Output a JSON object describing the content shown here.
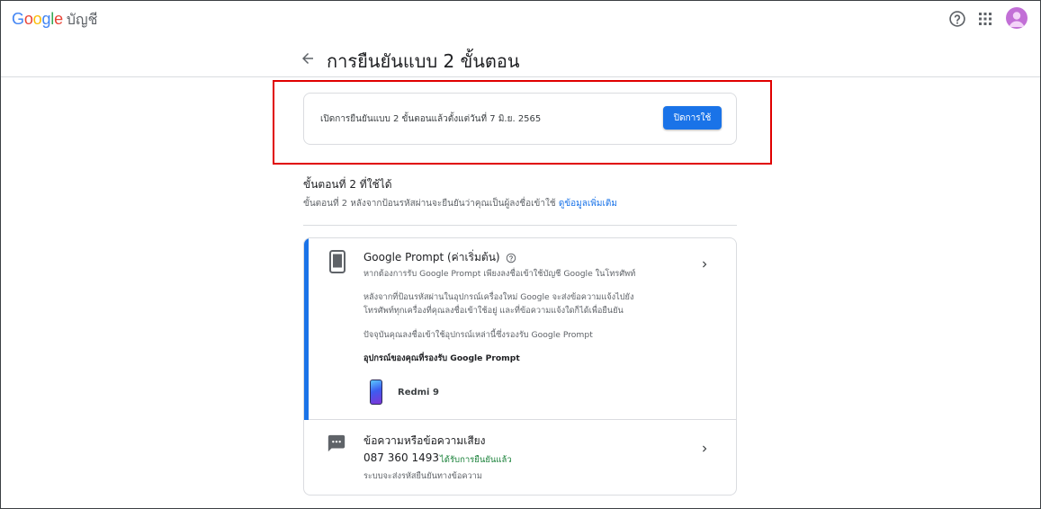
{
  "header": {
    "logo_text": "Google",
    "product_name": "บัญชี"
  },
  "page": {
    "title": "การยืนยันแบบ 2 ขั้นตอน"
  },
  "status": {
    "text": "เปิดการยืนยันแบบ 2 ขั้นตอนแล้วตั้งแต่วันที่ 7 มิ.ย. 2565",
    "disable_label": "ปิดการใช้"
  },
  "second_steps": {
    "title": "ขั้นตอนที่ 2 ที่ใช้ได้",
    "description": "ขั้นตอนที่ 2 หลังจากป้อนรหัสผ่านจะยืนยันว่าคุณเป็นผู้ลงชื่อเข้าใช้",
    "learn_more": "ดูข้อมูลเพิ่มเติม"
  },
  "google_prompt": {
    "title": "Google Prompt (ค่าเริ่มต้น)",
    "desc1": "หากต้องการรับ Google Prompt เพียงลงชื่อเข้าใช้บัญชี Google ในโทรศัพท์",
    "desc2": "หลังจากที่ป้อนรหัสผ่านในอุปกรณ์เครื่องใหม่ Google จะส่งข้อความแจ้งไปยังโทรศัพท์ทุกเครื่องที่คุณลงชื่อเข้าใช้อยู่ และที่ข้อความแจ้งใดก็ได้เพื่อยืนยัน",
    "desc3": "ปัจจุบันคุณลงชื่อเข้าใช้อุปกรณ์เหล่านี้ซึ่งรองรับ Google Prompt",
    "devices_heading": "อุปกรณ์ของคุณที่รองรับ Google Prompt",
    "devices": [
      {
        "name": "Redmi 9"
      }
    ]
  },
  "sms": {
    "title": "ข้อความหรือข้อความเสียง",
    "phone_number": "087 360 1493",
    "verified_label": "ได้รับการยืนยันแล้ว",
    "description": "ระบบจะส่งรหัสยืนยันทางข้อความ"
  },
  "colors": {
    "accent": "#1a73e8",
    "verified": "#188038",
    "highlight_border": "#e00000"
  }
}
